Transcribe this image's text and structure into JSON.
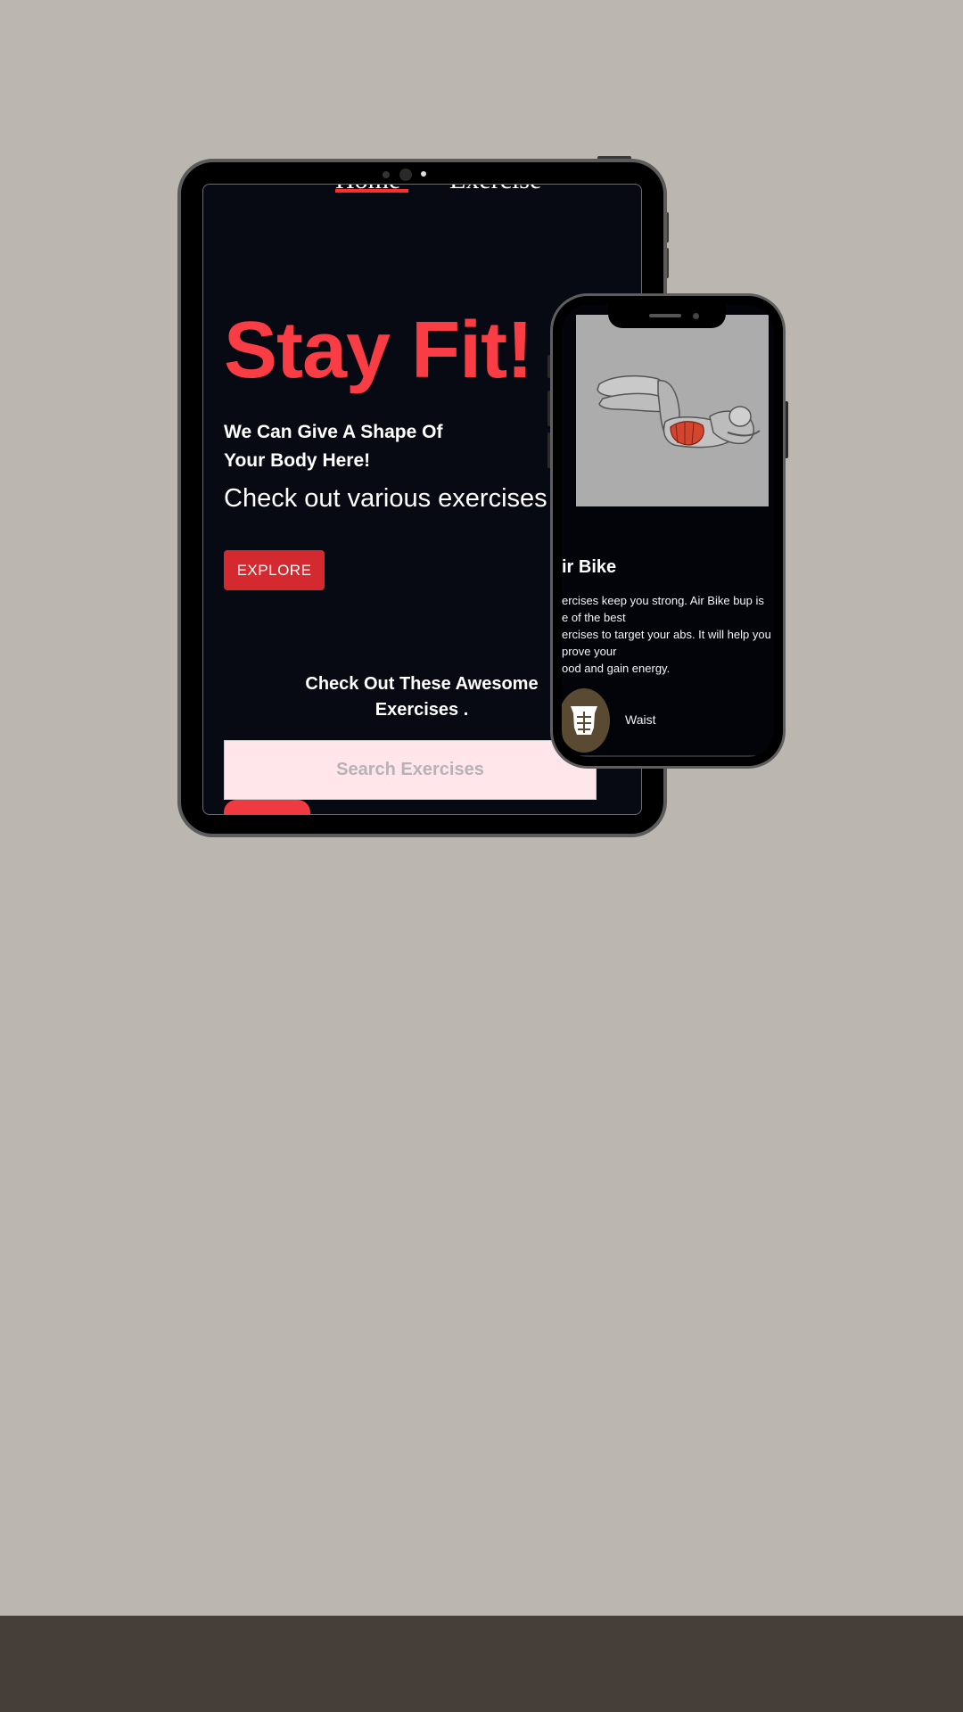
{
  "tablet": {
    "nav": {
      "home_label": "Home",
      "exercise_label": "Exercise"
    },
    "hero": {
      "title": "Stay Fit!",
      "subtitle_line1": "We Can Give A Shape Of",
      "subtitle_line2": "Your Body Here!",
      "description": "Check out various exercises",
      "explore_label": "EXPLORE"
    },
    "section": {
      "title_line1": "Check Out These Awesome",
      "title_line2": "Exercises ."
    },
    "search": {
      "placeholder": "Search Exercises"
    },
    "colors": {
      "accent": "#fa3d45",
      "button": "#d3292f",
      "screen_bg": "#080a13",
      "search_bg": "#ffe6ea"
    }
  },
  "phone": {
    "exercise": {
      "name": "ir Bike",
      "description_lines": [
        "ercises keep you strong. Air Bike bup is",
        "e of the best",
        "ercises to target your abs. It will help you",
        "prove your",
        "ood and gain energy."
      ],
      "body_part": "Waist",
      "body_part_icon": "abs-icon"
    }
  },
  "page": {
    "background": "#bbb6b0",
    "footer_color": "#463e39"
  }
}
